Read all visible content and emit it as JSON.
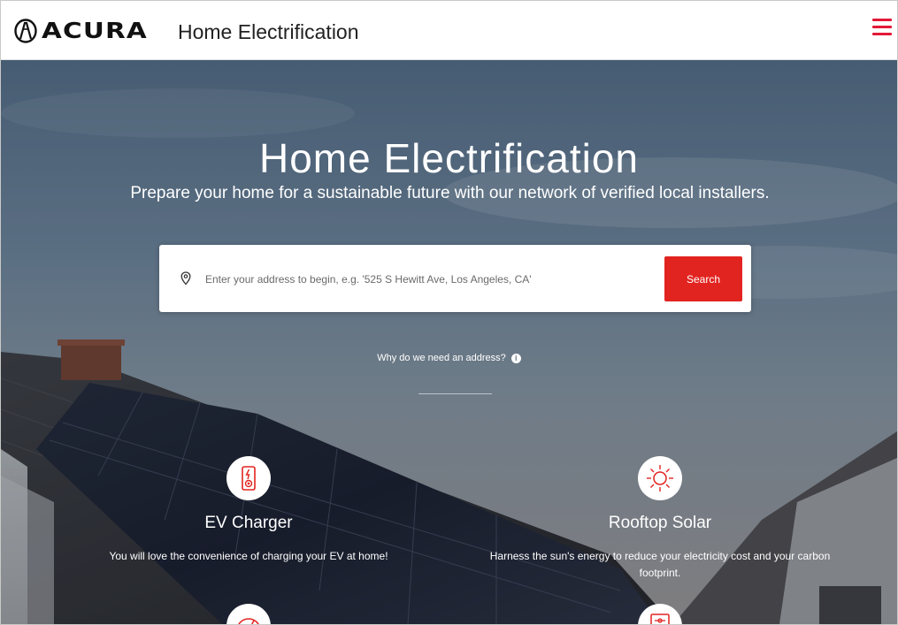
{
  "header": {
    "brand": "ACURA",
    "page_label": "Home Electrification",
    "menu_icon": "hamburger-menu-icon"
  },
  "hero": {
    "title": "Home Electrification",
    "subtitle": "Prepare your home for a sustainable future with our network of verified local installers."
  },
  "search": {
    "placeholder": "Enter your address to begin, e.g. '525 S Hewitt Ave, Los Angeles, CA'",
    "value": "",
    "button_label": "Search",
    "icon": "location-pin-icon"
  },
  "why_link": {
    "text": "Why do we need an address?",
    "icon": "info-icon"
  },
  "features": [
    {
      "title": "EV Charger",
      "description": "You will love the convenience of charging your EV at home!",
      "icon": "ev-charger-icon"
    },
    {
      "title": "Rooftop Solar",
      "description": "Harness the sun's energy to reduce your electricity cost and your carbon footprint.",
      "icon": "sun-icon"
    },
    {
      "title": "",
      "description": "",
      "icon": "gauge-icon"
    },
    {
      "title": "",
      "description": "",
      "icon": "battery-panel-icon"
    }
  ],
  "colors": {
    "accent": "#e22420",
    "menu": "#e31937",
    "header_bg": "#ffffff",
    "text_on_hero": "#ffffff"
  }
}
